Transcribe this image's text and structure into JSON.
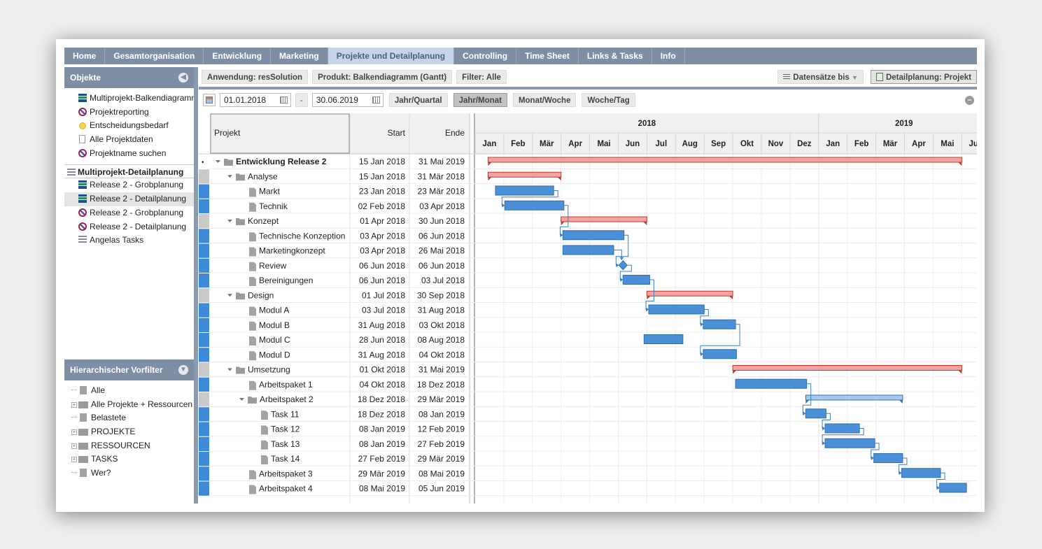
{
  "topnav": [
    "Home",
    "Gesamtorganisation",
    "Entwicklung",
    "Marketing",
    "Projekte und Detailplanung",
    "Controlling",
    "Time Sheet",
    "Links & Tasks",
    "Info"
  ],
  "active_tab_index": 4,
  "left": {
    "objects_title": "Objekte",
    "objects": [
      {
        "label": "Multiprojekt-Balkendiagramm",
        "icon": "gantt-icon"
      },
      {
        "label": "Projektreporting",
        "icon": "report-icon"
      },
      {
        "label": "Entscheidungsbedarf",
        "icon": "decision-icon"
      },
      {
        "label": "Alle Projektdaten",
        "icon": "document-icon"
      },
      {
        "label": "Projektname suchen",
        "icon": "report-icon"
      }
    ],
    "section_title": "Multiprojekt-Detailplanung",
    "section_items": [
      {
        "label": "Release 2 - Grobplanung",
        "icon": "gantt-icon"
      },
      {
        "label": "Release 2 - Detailplanung",
        "icon": "gantt-icon",
        "selected": true
      },
      {
        "label": "Release 2 - Grobplanung",
        "icon": "report-icon"
      },
      {
        "label": "Release 2 - Detailplanung",
        "icon": "report-icon"
      },
      {
        "label": "Angelas Tasks",
        "icon": "list-icon"
      }
    ],
    "filter_title": "Hierarchischer Vorfilter",
    "filter_items": [
      {
        "label": "Alle",
        "type": "file"
      },
      {
        "label": "Alle Projekte + Ressourcen",
        "type": "folder"
      },
      {
        "label": "Belastete",
        "type": "file"
      },
      {
        "label": "PROJEKTE",
        "type": "folder"
      },
      {
        "label": "RESSOURCEN",
        "type": "folder"
      },
      {
        "label": "TASKS",
        "type": "folder"
      },
      {
        "label": "Wer?",
        "type": "file"
      }
    ]
  },
  "toolbar": {
    "app": "Anwendung: resSolution",
    "product": "Produkt: Balkendiagramm (Gantt)",
    "filter": "Filter: Alle",
    "records": "Datensätze bis",
    "view": "Detailplanung: Projekt"
  },
  "range": {
    "from": "01.01.2018",
    "dash": "-",
    "to": "30.06.2019",
    "scales": [
      "Jahr/Quartal",
      "Jahr/Monat",
      "Monat/Woche",
      "Woche/Tag"
    ],
    "active_scale": 1
  },
  "columns": {
    "project": "Projekt",
    "start": "Start",
    "end": "Ende"
  },
  "years": [
    "2018",
    "2019"
  ],
  "months": [
    "Jan",
    "Feb",
    "Mär",
    "Apr",
    "Mai",
    "Jun",
    "Jul",
    "Aug",
    "Sep",
    "Okt",
    "Nov",
    "Dez",
    "Jan",
    "Feb",
    "Mär",
    "Apr",
    "Mai",
    "Jun"
  ],
  "colors": {
    "summary": "#f4a3a3",
    "summary_border": "#c0392b",
    "task": "#4a90d9",
    "task_border": "#2f6fad",
    "summary_light": "#a8c8ec",
    "header_bg": "#f0f0f0"
  },
  "rows": [
    {
      "name": "Entwicklung Release 2",
      "start": "15 Jan 2018",
      "end": "31 Mai 2019",
      "level": 0,
      "kind": "summary",
      "bold": true,
      "s": [
        2018,
        1,
        15
      ],
      "e": [
        2019,
        5,
        31
      ]
    },
    {
      "name": "Analyse",
      "start": "15 Jan 2018",
      "end": "31 Mär 2018",
      "level": 1,
      "kind": "summary",
      "s": [
        2018,
        1,
        15
      ],
      "e": [
        2018,
        3,
        31
      ]
    },
    {
      "name": "Markt",
      "start": "23 Jan 2018",
      "end": "23 Mär 2018",
      "level": 2,
      "kind": "task",
      "s": [
        2018,
        1,
        23
      ],
      "e": [
        2018,
        3,
        23
      ]
    },
    {
      "name": "Technik",
      "start": "02 Feb 2018",
      "end": "03 Apr 2018",
      "level": 2,
      "kind": "task",
      "s": [
        2018,
        2,
        2
      ],
      "e": [
        2018,
        4,
        3
      ]
    },
    {
      "name": "Konzept",
      "start": "01 Apr 2018",
      "end": "30 Jun 2018",
      "level": 1,
      "kind": "summary",
      "s": [
        2018,
        4,
        1
      ],
      "e": [
        2018,
        6,
        30
      ]
    },
    {
      "name": "Technische Konzeption",
      "start": "03 Apr 2018",
      "end": "06 Jun 2018",
      "level": 2,
      "kind": "task",
      "s": [
        2018,
        4,
        3
      ],
      "e": [
        2018,
        6,
        6
      ]
    },
    {
      "name": "Marketingkonzept",
      "start": "03 Apr 2018",
      "end": "26 Mai 2018",
      "level": 2,
      "kind": "task",
      "s": [
        2018,
        4,
        3
      ],
      "e": [
        2018,
        5,
        26
      ]
    },
    {
      "name": "Review",
      "start": "06 Jun 2018",
      "end": "06 Jun 2018",
      "level": 2,
      "kind": "milestone",
      "s": [
        2018,
        6,
        6
      ],
      "e": [
        2018,
        6,
        6
      ]
    },
    {
      "name": "Bereinigungen",
      "start": "06 Jun 2018",
      "end": "03 Jul 2018",
      "level": 2,
      "kind": "task",
      "s": [
        2018,
        6,
        6
      ],
      "e": [
        2018,
        7,
        3
      ]
    },
    {
      "name": "Design",
      "start": "01 Jul 2018",
      "end": "30 Sep 2018",
      "level": 1,
      "kind": "summary",
      "s": [
        2018,
        7,
        1
      ],
      "e": [
        2018,
        9,
        30
      ]
    },
    {
      "name": "Modul A",
      "start": "03 Jul 2018",
      "end": "31 Aug 2018",
      "level": 2,
      "kind": "task",
      "s": [
        2018,
        7,
        3
      ],
      "e": [
        2018,
        8,
        31
      ]
    },
    {
      "name": "Modul B",
      "start": "31 Aug 2018",
      "end": "03 Okt 2018",
      "level": 2,
      "kind": "task",
      "s": [
        2018,
        8,
        31
      ],
      "e": [
        2018,
        10,
        3
      ]
    },
    {
      "name": "Modul C",
      "start": "28 Jun 2018",
      "end": "08 Aug 2018",
      "level": 2,
      "kind": "task",
      "s": [
        2018,
        6,
        28
      ],
      "e": [
        2018,
        8,
        8
      ]
    },
    {
      "name": "Modul D",
      "start": "31 Aug 2018",
      "end": "04 Okt 2018",
      "level": 2,
      "kind": "task",
      "s": [
        2018,
        8,
        31
      ],
      "e": [
        2018,
        10,
        4
      ]
    },
    {
      "name": "Umsetzung",
      "start": "01 Okt 2018",
      "end": "31 Mai 2019",
      "level": 1,
      "kind": "summary",
      "s": [
        2018,
        10,
        1
      ],
      "e": [
        2019,
        5,
        31
      ]
    },
    {
      "name": "Arbeitspaket 1",
      "start": "04 Okt 2018",
      "end": "18 Dez 2018",
      "level": 2,
      "kind": "task",
      "s": [
        2018,
        10,
        4
      ],
      "e": [
        2018,
        12,
        18
      ]
    },
    {
      "name": "Arbeitspaket 2",
      "start": "18 Dez 2018",
      "end": "29 Mär 2019",
      "level": 2,
      "kind": "summary2",
      "s": [
        2018,
        12,
        18
      ],
      "e": [
        2019,
        3,
        29
      ]
    },
    {
      "name": "Task 11",
      "start": "18 Dez 2018",
      "end": "08 Jan 2019",
      "level": 3,
      "kind": "task",
      "s": [
        2018,
        12,
        18
      ],
      "e": [
        2019,
        1,
        8
      ]
    },
    {
      "name": "Task 12",
      "start": "08 Jan 2019",
      "end": "12 Feb 2019",
      "level": 3,
      "kind": "task",
      "s": [
        2019,
        1,
        8
      ],
      "e": [
        2019,
        2,
        12
      ]
    },
    {
      "name": "Task 13",
      "start": "08 Jan 2019",
      "end": "27 Feb 2019",
      "level": 3,
      "kind": "task",
      "s": [
        2019,
        1,
        8
      ],
      "e": [
        2019,
        2,
        27
      ]
    },
    {
      "name": "Task 14",
      "start": "27 Feb 2019",
      "end": "29 Mär 2019",
      "level": 3,
      "kind": "task",
      "s": [
        2019,
        2,
        27
      ],
      "e": [
        2019,
        3,
        29
      ]
    },
    {
      "name": "Arbeitspaket 3",
      "start": "29 Mär 2019",
      "end": "08 Mai 2019",
      "level": 2,
      "kind": "task",
      "s": [
        2019,
        3,
        29
      ],
      "e": [
        2019,
        5,
        8
      ]
    },
    {
      "name": "Arbeitspaket 4",
      "start": "08 Mai 2019",
      "end": "05 Jun 2019",
      "level": 2,
      "kind": "task",
      "s": [
        2019,
        5,
        8
      ],
      "e": [
        2019,
        6,
        5
      ]
    }
  ],
  "dependencies": [
    [
      2,
      3
    ],
    [
      3,
      5
    ],
    [
      5,
      7
    ],
    [
      6,
      7
    ],
    [
      7,
      8
    ],
    [
      8,
      10
    ],
    [
      10,
      11
    ],
    [
      11,
      13
    ],
    [
      15,
      17
    ],
    [
      17,
      18
    ],
    [
      18,
      19
    ],
    [
      19,
      20
    ],
    [
      20,
      21
    ],
    [
      21,
      22
    ]
  ]
}
